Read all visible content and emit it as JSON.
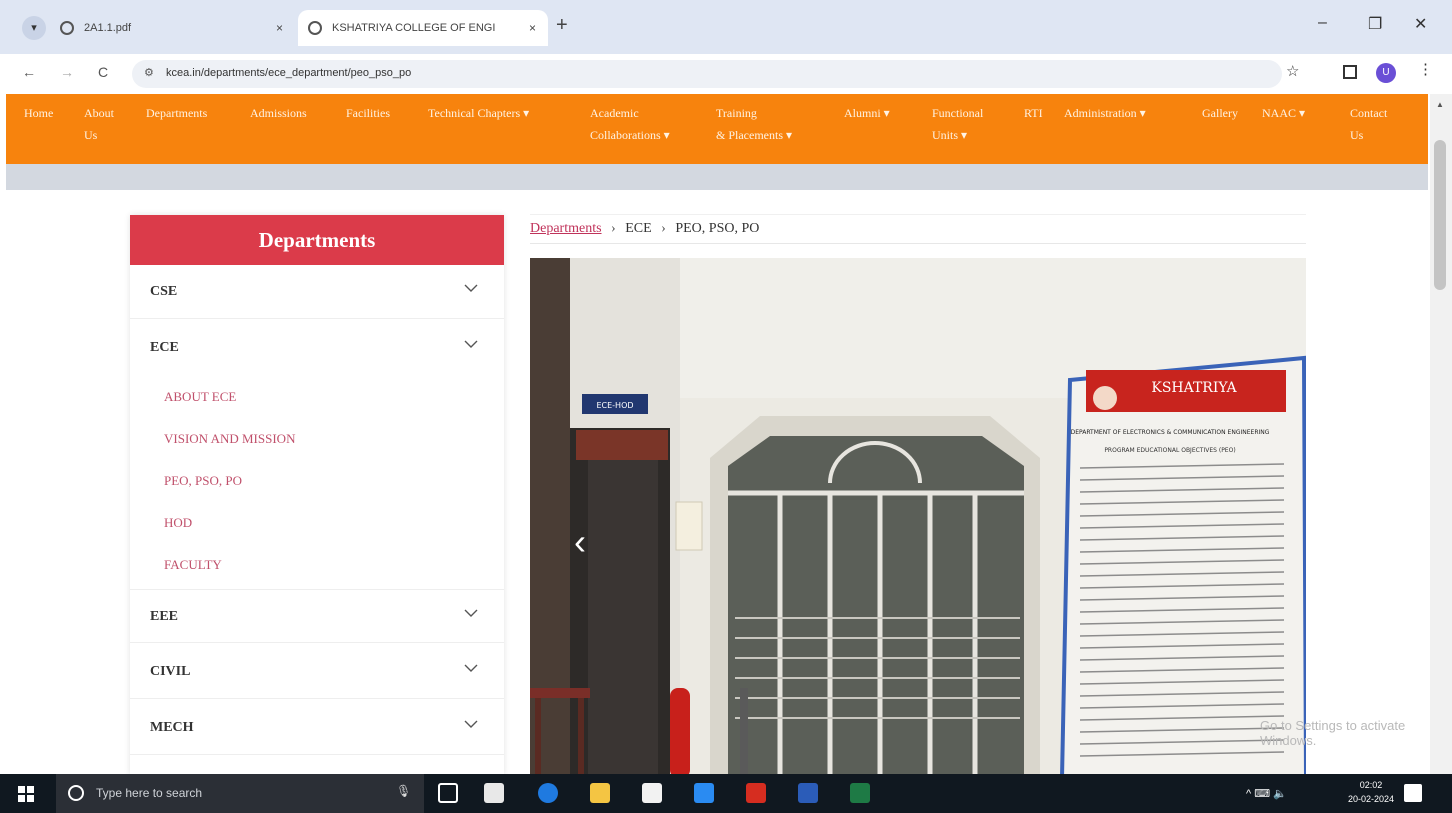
{
  "browser": {
    "tabs": [
      {
        "title": "2A1.1.pdf",
        "close": "×"
      },
      {
        "title": "KSHATRIYA COLLEGE OF ENGI",
        "close": "×"
      }
    ],
    "tab_search": "▾",
    "new_tab": "+",
    "window_controls": {
      "minimize": "–",
      "maximize": "❐",
      "close": "✕"
    },
    "nav": {
      "back": "←",
      "forward": "→",
      "reload": "C"
    },
    "url": "kcea.in/departments/ece_department/peo_pso_po",
    "site_info": "⚙",
    "star": "☆",
    "profile": "U",
    "menu": "⋮"
  },
  "site_nav": [
    "Home",
    "About\nUs",
    "Departments",
    "Admissions",
    "Facilities",
    "Technical Chapters ▾",
    "Academic\nCollaborations ▾",
    "Training\n& Placements ▾",
    "Alumni ▾",
    "Functional\nUnits ▾",
    "RTI",
    "Administration ▾",
    "Gallery",
    "NAAC ▾",
    "Contact\nUs"
  ],
  "sidebar": {
    "title": "Departments",
    "sections": [
      {
        "label": "CSE"
      },
      {
        "label": "ECE"
      },
      {
        "label": "EEE"
      },
      {
        "label": "CIVIL"
      },
      {
        "label": "MECH"
      }
    ],
    "ece_items": [
      "ABOUT ECE",
      "VISION AND MISSION",
      "PEO, PSO, PO",
      "HOD",
      "FACULTY"
    ]
  },
  "breadcrumb": {
    "link": "Departments",
    "separator": "›",
    "items": [
      "ECE",
      "PEO, PSO, PO"
    ]
  },
  "carousel": {
    "prev": "‹",
    "board_heading": "KSHATRIYA",
    "room_sign": "ECE-HOD",
    "notice_title": "DEPARTMENT OF ELECTRONICS & COMMUNICATION ENGINEERING",
    "notice_sub": "PROGRAM EDUCATIONAL OBJECTIVES (PEO)"
  },
  "watermark": "Go to Settings to activate Windows.",
  "taskbar": {
    "search_placeholder": "Type here to search",
    "mic": "🎙",
    "tray": "^ ⌨ 🔈",
    "time": "02:02",
    "date": "20-02-2024"
  },
  "colors": {
    "nav_orange": "#f7830d",
    "sidebar_header": "#db3b4a",
    "link": "#c0325a",
    "submenu": "#c0506b"
  }
}
